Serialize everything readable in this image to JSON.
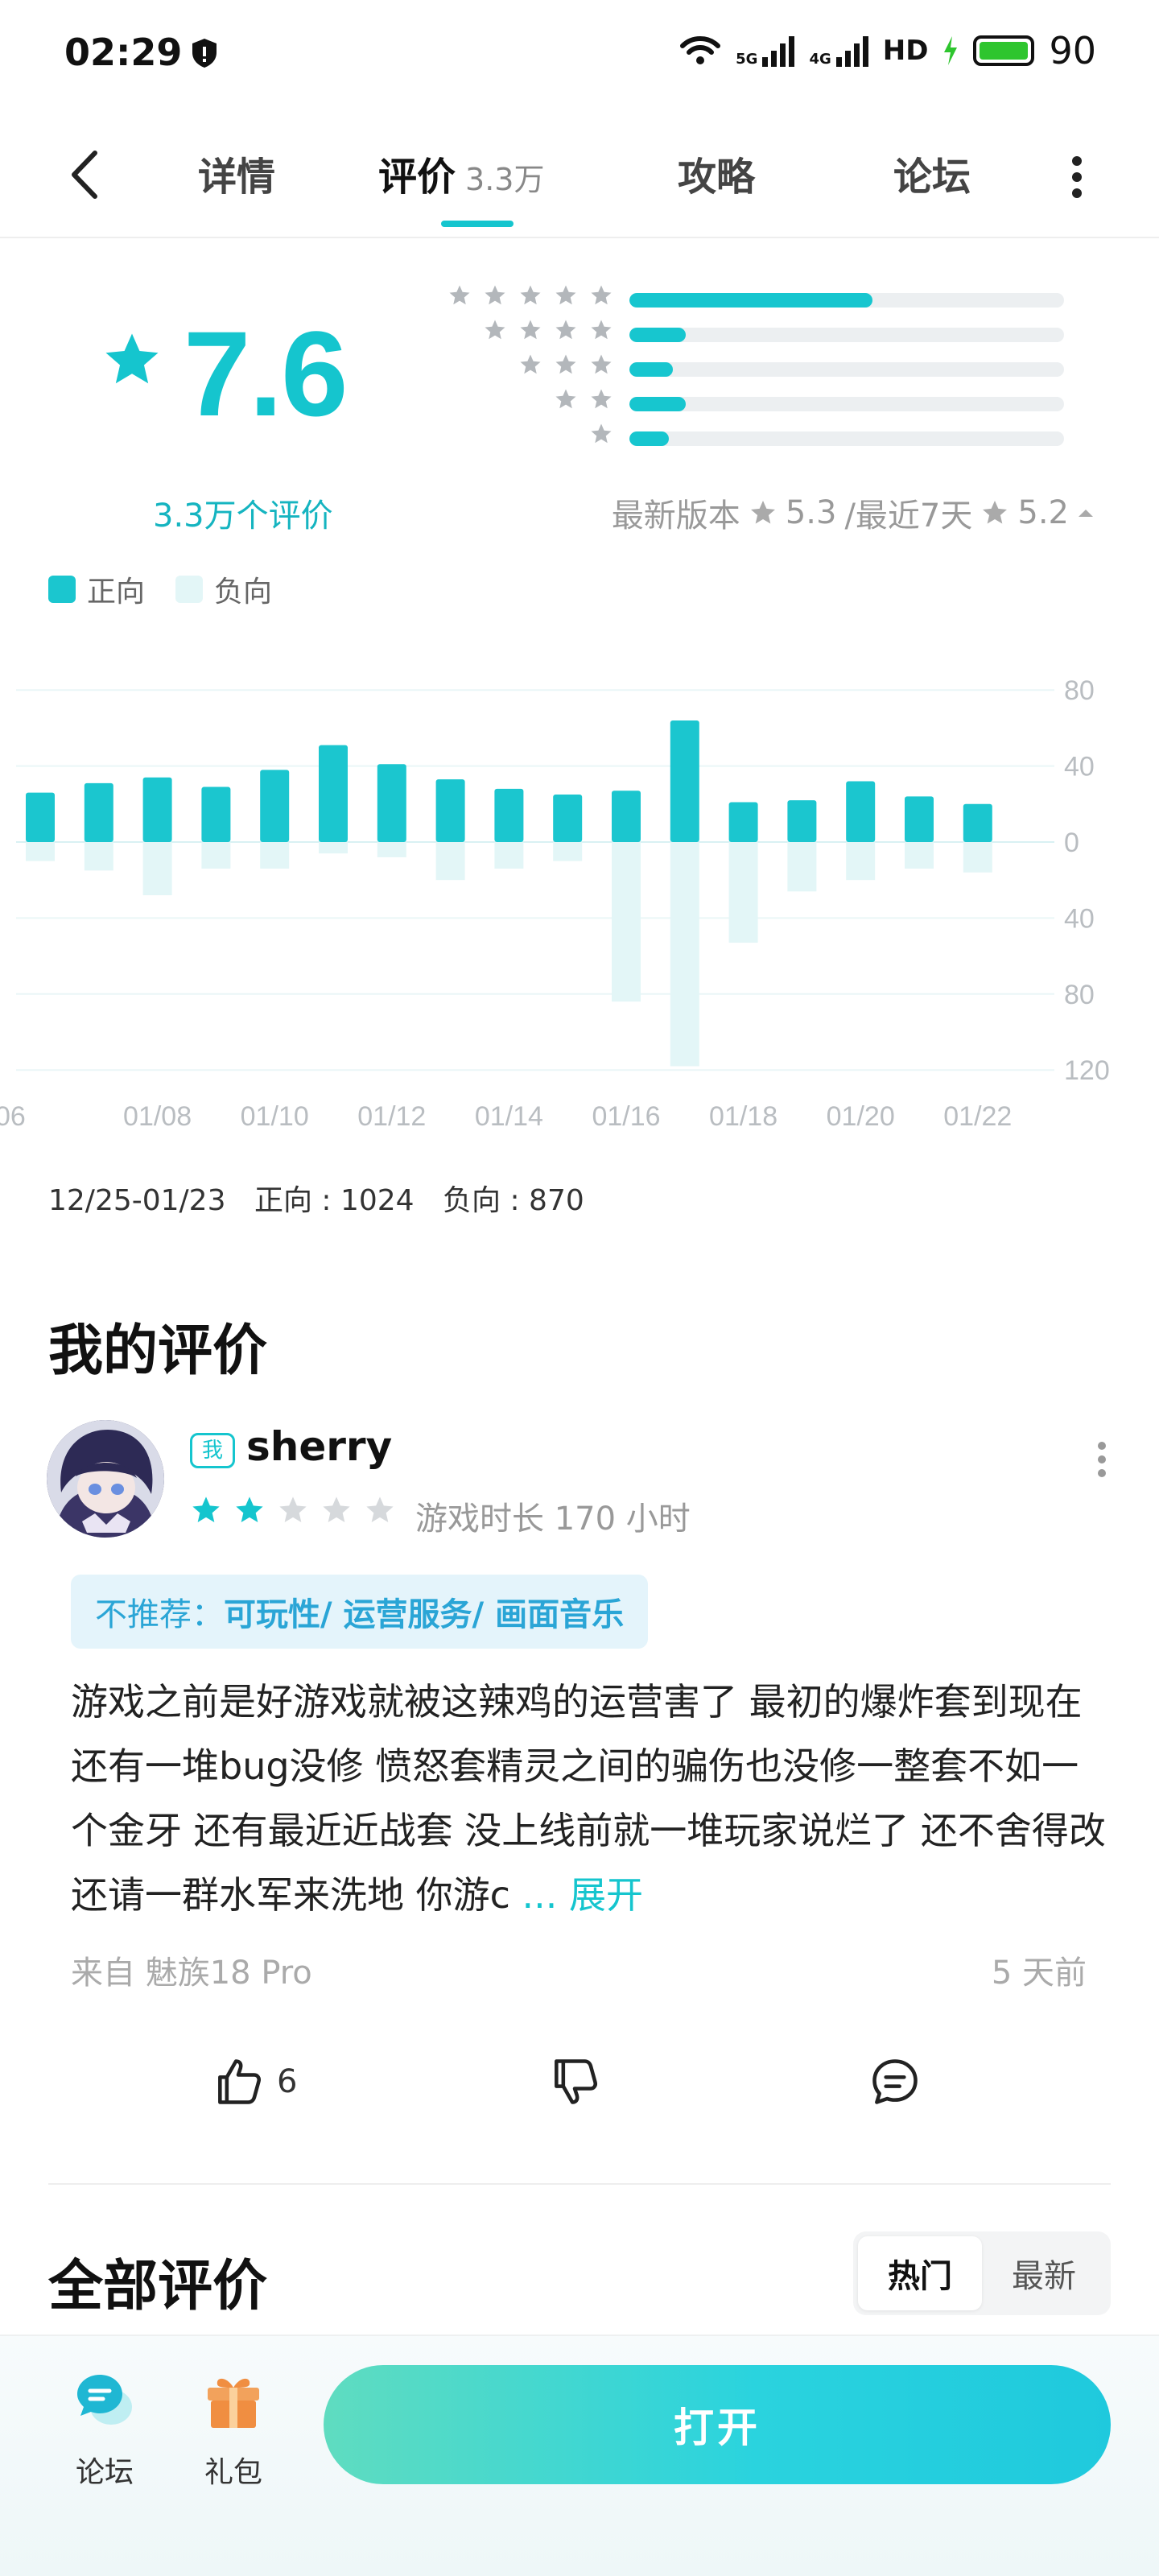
{
  "status_bar": {
    "time": "02:29",
    "network_5g": "5G",
    "network_4g": "4G",
    "hd": "HD",
    "battery": "90",
    "battery_color": "#2ec52e"
  },
  "nav": {
    "tabs": [
      {
        "label": "详情"
      },
      {
        "label": "评价",
        "count": "3.3万"
      },
      {
        "label": "攻略"
      },
      {
        "label": "论坛"
      }
    ],
    "accent": "#15c5ce"
  },
  "rating": {
    "score": "7.6",
    "count_label": "3.3万个评价",
    "distribution": [
      {
        "stars": 5,
        "fraction": 0.56
      },
      {
        "stars": 4,
        "fraction": 0.13
      },
      {
        "stars": 3,
        "fraction": 0.1
      },
      {
        "stars": 2,
        "fraction": 0.13
      },
      {
        "stars": 1,
        "fraction": 0.09
      }
    ],
    "latest_version_label": "最新版本",
    "latest_version_score": "5.3",
    "recent_label": "/最近7天",
    "recent_score": "5.2"
  },
  "legend": {
    "positive": "正向",
    "negative": "负向",
    "positive_color": "#1bc6cf",
    "negative_color": "#e3f6f7"
  },
  "chart_data": {
    "type": "bar",
    "categories": [
      "01/07",
      "01/08",
      "01/09",
      "01/10",
      "01/11",
      "01/12",
      "01/13",
      "01/14",
      "01/15",
      "01/16",
      "01/17",
      "01/18",
      "01/19",
      "01/20",
      "01/21",
      "01/22",
      "01/23"
    ],
    "x_tick_labels": [
      "06",
      "01/08",
      "01/10",
      "01/12",
      "01/14",
      "01/16",
      "01/18",
      "01/20",
      "01/22"
    ],
    "y_tick_labels": [
      "80",
      "40",
      "0",
      "40",
      "80",
      "120"
    ],
    "series": [
      {
        "name": "正向",
        "values": [
          26,
          31,
          34,
          29,
          38,
          51,
          41,
          33,
          28,
          25,
          27,
          64,
          21,
          22,
          32,
          24,
          20
        ]
      },
      {
        "name": "负向",
        "values": [
          -10,
          -15,
          -28,
          -14,
          -14,
          -6,
          -8,
          -20,
          -14,
          -10,
          -84,
          -118,
          -53,
          -26,
          -20,
          -14,
          -16
        ]
      }
    ],
    "ylim": [
      -120,
      80
    ],
    "grid": true,
    "summary": {
      "range": "12/25-01/23",
      "positive": "正向 : 1024",
      "negative": "负向 : 870"
    }
  },
  "my_review": {
    "section_title": "我的评价",
    "me_tag": "我",
    "username": "sherry",
    "stars": 2,
    "playtime": "游戏时长 170 小时",
    "tag_key": "不推荐：",
    "tag_values": "可玩性/ 运营服务/ 画面音乐",
    "text": "游戏之前是好游戏就被这辣鸡的运营害了 最初的爆炸套到现在还有一堆bug没修 愤怒套精灵之间的骗伤也没修一整套不如一个金牙 还有最近近战套 没上线前就一堆玩家说烂了 还不舍得改 还请一群水军来洗地 你游c",
    "expand": "... 展开",
    "device": "来自 魅族18 Pro",
    "time_ago": "5 天前",
    "likes": "6"
  },
  "all_reviews": {
    "section_title": "全部评价",
    "sort_options": [
      "热门",
      "最新"
    ]
  },
  "bottom_bar": {
    "forum_label": "论坛",
    "gift_label": "礼包",
    "open_label": "打开"
  }
}
